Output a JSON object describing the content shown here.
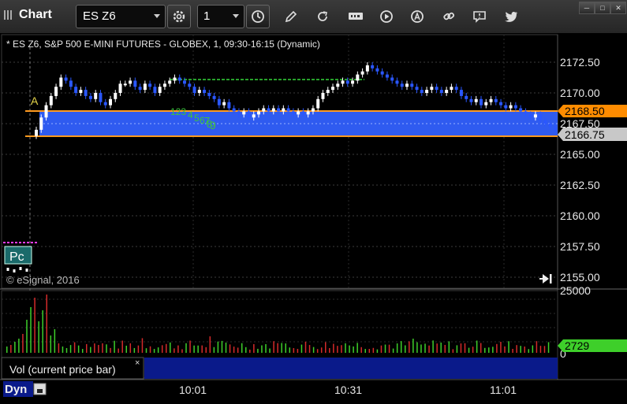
{
  "toolbar": {
    "title": "Chart",
    "symbol": "ES Z6",
    "interval": "1",
    "icons": [
      "gear-icon",
      "clock-icon",
      "pencil-icon",
      "refresh-icon",
      "get-icon",
      "play-icon",
      "alert-icon",
      "link-icon",
      "comment-icon",
      "twitter-icon"
    ],
    "window_buttons": [
      "minimize",
      "maximize",
      "close"
    ]
  },
  "chart": {
    "header": "* ES Z6, S&P 500 E-MINI FUTURES - GLOBEX, 1, 09:30-16:15 (Dynamic)",
    "copyright": "© eSignal, 2016",
    "price_ticks": [
      "2172.50",
      "2170.00",
      "2167.50",
      "2165.00",
      "2162.50",
      "2160.00",
      "2157.50",
      "2155.00"
    ],
    "price_flag_upper": "2168.50",
    "price_flag_last": "2166.75",
    "marker_a": "A",
    "marker_pc": "Pc",
    "td_counts": [
      "123",
      "4",
      "5",
      "6",
      "7",
      "8",
      "9"
    ],
    "colors": {
      "upper_flag": "#ff8c00",
      "last_flag": "#c8c8c8",
      "band": "#2f5bf0",
      "band_line": "#ff9a20",
      "up_bar": "#ffffff",
      "down_bar": "#2a57ff"
    }
  },
  "volume": {
    "study_label": "Vol (current price bar)",
    "top_tick": "25000",
    "bottom_tick": "0",
    "current": "2729",
    "current_color": "#3ecf2a"
  },
  "time_axis": {
    "labels": [
      "10:01",
      "10:31",
      "11:01"
    ],
    "mode": "Dyn"
  },
  "chart_data": {
    "type": "candlestick",
    "title": "ES Z6, S&P 500 E-MINI FUTURES - GLOBEX, 1, 09:30-16:15 (Dynamic)",
    "ylim": [
      2154.5,
      2174
    ],
    "session_levels": {
      "band_top": 2168.5,
      "band_bottom": 2166.5,
      "last": 2166.75
    },
    "closes": [
      2167.0,
      2168.0,
      2169.0,
      2169.75,
      2170.5,
      2171.25,
      2171.0,
      2170.5,
      2170.0,
      2170.25,
      2169.75,
      2169.5,
      2170.0,
      2169.25,
      2169.0,
      2169.5,
      2170.0,
      2170.75,
      2170.75,
      2171.0,
      2170.5,
      2170.25,
      2170.75,
      2170.5,
      2170.0,
      2170.5,
      2170.75,
      2171.0,
      2171.25,
      2171.0,
      2170.75,
      2170.5,
      2170.0,
      2170.25,
      2170.0,
      2169.75,
      2169.5,
      2169.0,
      2169.25,
      2168.75,
      2168.5,
      2168.25,
      2168.5,
      2168.0,
      2168.25,
      2168.5,
      2168.75,
      2168.5,
      2168.75,
      2168.5,
      2168.75,
      2168.5,
      2168.25,
      2168.5,
      2168.25,
      2168.5,
      2168.75,
      2169.5,
      2170.0,
      2170.25,
      2170.5,
      2170.75,
      2171.0,
      2170.75,
      2171.0,
      2171.5,
      2171.75,
      2172.25,
      2172.0,
      2171.75,
      2171.5,
      2171.25,
      2171.0,
      2170.75,
      2170.5,
      2170.75,
      2170.5,
      2170.25,
      2170.0,
      2170.25,
      2170.5,
      2170.25,
      2170.0,
      2170.25,
      2170.5,
      2170.25,
      2169.75,
      2169.5,
      2169.25,
      2169.5,
      2169.0,
      2169.25,
      2169.5,
      2169.25,
      2169.0,
      2168.75,
      2169.0,
      2168.75,
      2168.5,
      2168.25,
      2168.0,
      2168.25,
      2167.75,
      2167.5,
      2167.25,
      2167.0
    ]
  }
}
